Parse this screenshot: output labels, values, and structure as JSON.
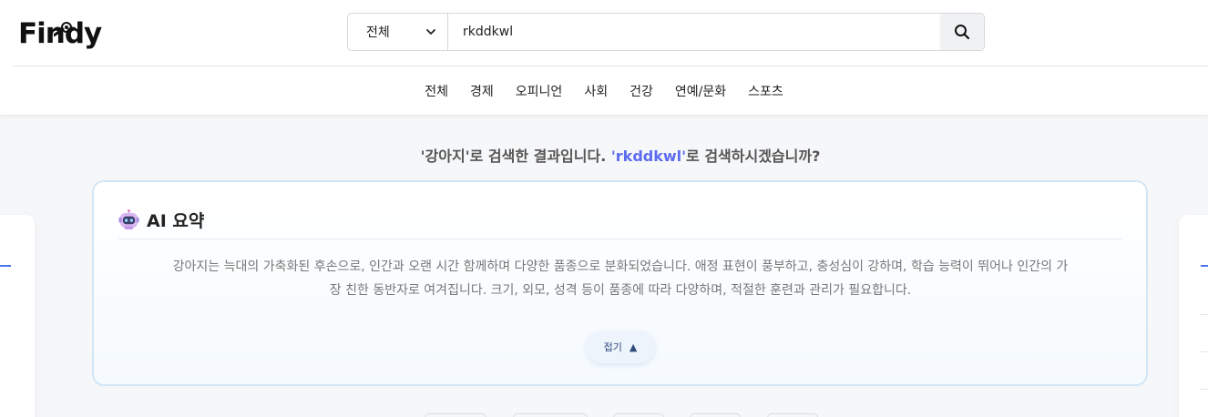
{
  "brand": {
    "logo_text": "Findy"
  },
  "search": {
    "category": "전체",
    "query": "rkddkwl"
  },
  "nav": {
    "items": [
      "전체",
      "경제",
      "오피니언",
      "사회",
      "건강",
      "연예/문화",
      "스포츠"
    ]
  },
  "notice": {
    "quote_open": "'",
    "corrected_keyword": "강아지",
    "quote_close_1": "'",
    "text_1": "로 검색한 결과입니다. ",
    "quote_open_2": "'",
    "original_keyword": "rkddkwl",
    "quote_close_2": "'",
    "text_2": "로 검색하시겠습니까?"
  },
  "ai_summary": {
    "title": "AI 요약",
    "line_1": "강아지는 늑대의 가축화된 후손으로, 인간과 오랜 시간 함께하며 다양한 품종으로 분화되었습니다. 애정 표현이 풍부하고, 충성심이 강하며, 학습 능력이 뛰어나 인간의 가",
    "line_2": "장 친한 동반자로 여겨집니다. 크기, 외모, 성격 등이 품종에 따라 다양하며, 적절한 훈련과 관리가 필요합니다.",
    "collapse_label": "접기",
    "collapse_arrow": "▲"
  },
  "colors": {
    "accent_link": "#5c6bf0",
    "card_border": "#d3e6f6",
    "side_accent": "#4a76e8"
  },
  "icons": {
    "search": "search-icon",
    "dropdown": "chevron-down-icon",
    "robot": "robot-icon",
    "collapse": "triangle-up-icon"
  }
}
